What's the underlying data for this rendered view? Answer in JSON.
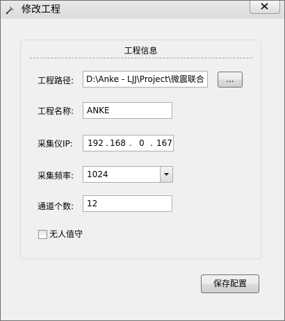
{
  "window": {
    "title": "修改工程",
    "close_icon": "close-icon",
    "app_icon": "tools-icon"
  },
  "group": {
    "title": "工程信息"
  },
  "form": {
    "path_label": "工程路径:",
    "path_value": "D:\\Anke - LJJ\\Project\\微震联合",
    "browse_label": "...",
    "name_label": "工程名称:",
    "name_value": "ANKE",
    "ip_label": "采集仪IP:",
    "ip_octets": [
      "192",
      "168",
      "0",
      "167"
    ],
    "ip_dots": [
      ".",
      ".",
      "."
    ],
    "freq_label": "采集频率:",
    "freq_value": "1024",
    "channels_label": "通道个数:",
    "channels_value": "12",
    "unattended_label": "无人值守",
    "unattended_checked": false
  },
  "footer": {
    "save_label": "保存配置"
  }
}
